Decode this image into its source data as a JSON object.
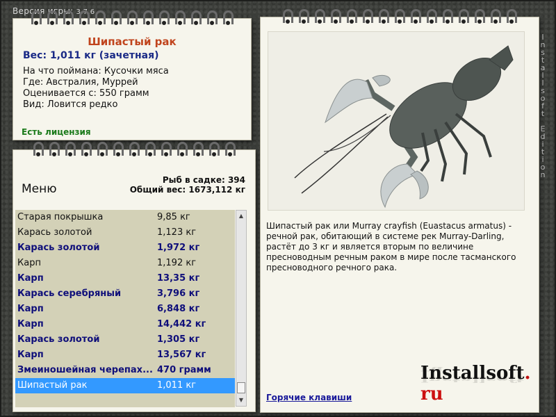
{
  "app": {
    "version_label": "Версия игры:",
    "version": "3.7.6",
    "edition_text": "Installsoft Edition"
  },
  "fish": {
    "name": "Шипастый рак",
    "weight": "Вес: 1,011 кг (зачетная)",
    "bait": "На что поймана: Кусочки мяса",
    "location": "Где: Австралия, Муррей",
    "value": "Оценивается с: 550 грамм",
    "rarity": "Вид: Ловится редко",
    "license": "Есть лицензия"
  },
  "menu": {
    "title": "Меню",
    "fish_in_keepnet": "Рыб в садке: 394",
    "total_weight": "Общий вес: 1673,112 кг",
    "items": [
      {
        "name": "Старая покрышка",
        "weight": "9,85 кг",
        "bold": false
      },
      {
        "name": "Карась золотой",
        "weight": "1,123 кг",
        "bold": false
      },
      {
        "name": "Карась золотой",
        "weight": "1,972 кг",
        "bold": true
      },
      {
        "name": "Карп",
        "weight": "1,192 кг",
        "bold": false
      },
      {
        "name": "Карп",
        "weight": "13,35 кг",
        "bold": true
      },
      {
        "name": "Карась серебряный",
        "weight": "3,796 кг",
        "bold": true
      },
      {
        "name": "Карп",
        "weight": "6,848 кг",
        "bold": true
      },
      {
        "name": "Карп",
        "weight": "14,442 кг",
        "bold": true
      },
      {
        "name": "Карась золотой",
        "weight": "1,305 кг",
        "bold": true
      },
      {
        "name": "Карп",
        "weight": "13,567 кг",
        "bold": true
      },
      {
        "name": "Змеиношейная черепах...",
        "weight": "470 грамм",
        "bold": true
      },
      {
        "name": "Шипастый рак",
        "weight": "1,011 кг",
        "bold": false,
        "selected": true
      }
    ]
  },
  "description": "Шипастый рак или Murray crayfish (Euastacus armatus) - речной рак, обитающий в системе рек Murray-Darling, растёт до 3 кг и является вторым по величине пресноводным речным раком в мире после тасманского пресноводного речного рака.",
  "logo": {
    "main": "Installsoft",
    "dot": ".",
    "tld": "ru"
  },
  "hotkeys_label": "Горячие клавиши",
  "colors": {
    "accent_title": "#c0441d",
    "bold_entry": "#0f0f7a",
    "license": "#1a7a1a",
    "selection": "#3399ff",
    "logo_tld": "#cc1010"
  }
}
